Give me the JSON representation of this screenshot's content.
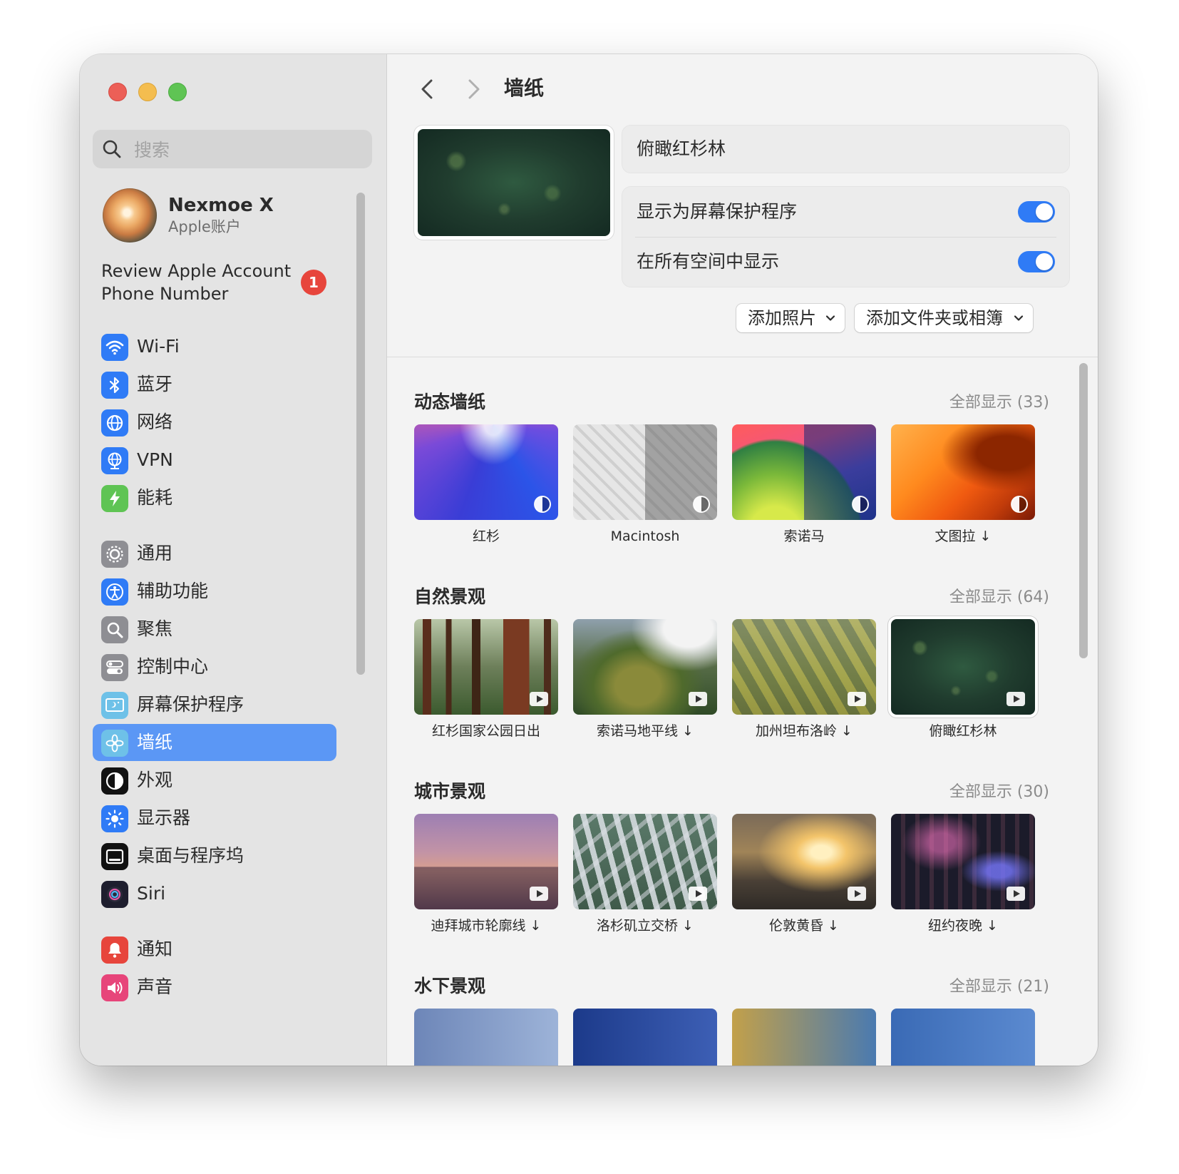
{
  "sidebar": {
    "search_placeholder": "搜索",
    "account": {
      "name": "Nexmoe X",
      "subtitle": "Apple账户"
    },
    "review": {
      "text": "Review Apple Account Phone Number",
      "badge": "1"
    },
    "items": [
      {
        "label": "Wi-Fi",
        "icon": "wifi-icon",
        "color": "#2f7bf6"
      },
      {
        "label": "蓝牙",
        "icon": "bluetooth-icon",
        "color": "#2f7bf6"
      },
      {
        "label": "网络",
        "icon": "globe-icon",
        "color": "#2f7bf6"
      },
      {
        "label": "VPN",
        "icon": "vpn-globe-icon",
        "color": "#2f7bf6"
      },
      {
        "label": "能耗",
        "icon": "battery-bolt-icon",
        "color": "#5fc454"
      },
      {
        "label": "通用",
        "icon": "gear-icon",
        "color": "#8e8e93"
      },
      {
        "label": "辅助功能",
        "icon": "accessibility-icon",
        "color": "#2f7bf6"
      },
      {
        "label": "聚焦",
        "icon": "spotlight-icon",
        "color": "#8e8e93"
      },
      {
        "label": "控制中心",
        "icon": "control-center-icon",
        "color": "#8e8e93"
      },
      {
        "label": "屏幕保护程序",
        "icon": "screensaver-icon",
        "color": "#6ec1e8"
      },
      {
        "label": "墙纸",
        "icon": "wallpaper-icon",
        "color": "#6ec1e8",
        "active": true
      },
      {
        "label": "外观",
        "icon": "appearance-icon",
        "color": "#111111"
      },
      {
        "label": "显示器",
        "icon": "display-icon",
        "color": "#2f7bf6"
      },
      {
        "label": "桌面与程序坞",
        "icon": "dock-icon",
        "color": "#111111"
      },
      {
        "label": "Siri",
        "icon": "siri-icon",
        "color": "#1e1e2e"
      },
      {
        "label": "通知",
        "icon": "notification-icon",
        "color": "#e7453c"
      },
      {
        "label": "声音",
        "icon": "sound-icon",
        "color": "#e7457a"
      }
    ]
  },
  "main": {
    "title": "墙纸",
    "current_name": "俯瞰红杉林",
    "options": [
      {
        "label": "显示为屏幕保护程序",
        "on": true
      },
      {
        "label": "在所有空间中显示",
        "on": true
      }
    ],
    "buttons": {
      "add_photo": "添加照片",
      "add_folder": "添加文件夹或相簿"
    }
  },
  "gallery": {
    "sections": [
      {
        "title": "动态墙纸",
        "more": "全部显示 (33)",
        "items": [
          {
            "caption": "红杉",
            "art": "sequoia",
            "kind": "dynamic"
          },
          {
            "caption": "Macintosh",
            "art": "mac",
            "kind": "dynamic"
          },
          {
            "caption": "索诺马",
            "art": "sonoma",
            "kind": "dynamic"
          },
          {
            "caption": "文图拉 ↓",
            "art": "ventura",
            "kind": "dynamic"
          }
        ]
      },
      {
        "title": "自然景观",
        "more": "全部显示 (64)",
        "items": [
          {
            "caption": "红杉国家公园日出",
            "art": "redwood",
            "kind": "video"
          },
          {
            "caption": "索诺马地平线 ↓",
            "art": "sonomahz",
            "kind": "video"
          },
          {
            "caption": "加州坦布洛岭 ↓",
            "art": "tabletop",
            "kind": "video"
          },
          {
            "caption": "俯瞰红杉林",
            "art": "forest",
            "kind": "video",
            "selected": true
          }
        ]
      },
      {
        "title": "城市景观",
        "more": "全部显示 (30)",
        "items": [
          {
            "caption": "迪拜城市轮廓线 ↓",
            "art": "dubai",
            "kind": "video"
          },
          {
            "caption": "洛杉矶立交桥 ↓",
            "art": "la",
            "kind": "video"
          },
          {
            "caption": "伦敦黄昏 ↓",
            "art": "london",
            "kind": "video"
          },
          {
            "caption": "纽约夜晚 ↓",
            "art": "nyc",
            "kind": "video"
          }
        ]
      },
      {
        "title": "水下景观",
        "more": "全部显示 (21)",
        "items": [
          {
            "caption": "",
            "art": "uw1",
            "kind": "video"
          },
          {
            "caption": "",
            "art": "uw2",
            "kind": "video"
          },
          {
            "caption": "",
            "art": "uw3",
            "kind": "video"
          },
          {
            "caption": "",
            "art": "uw4",
            "kind": "video"
          }
        ]
      }
    ]
  }
}
